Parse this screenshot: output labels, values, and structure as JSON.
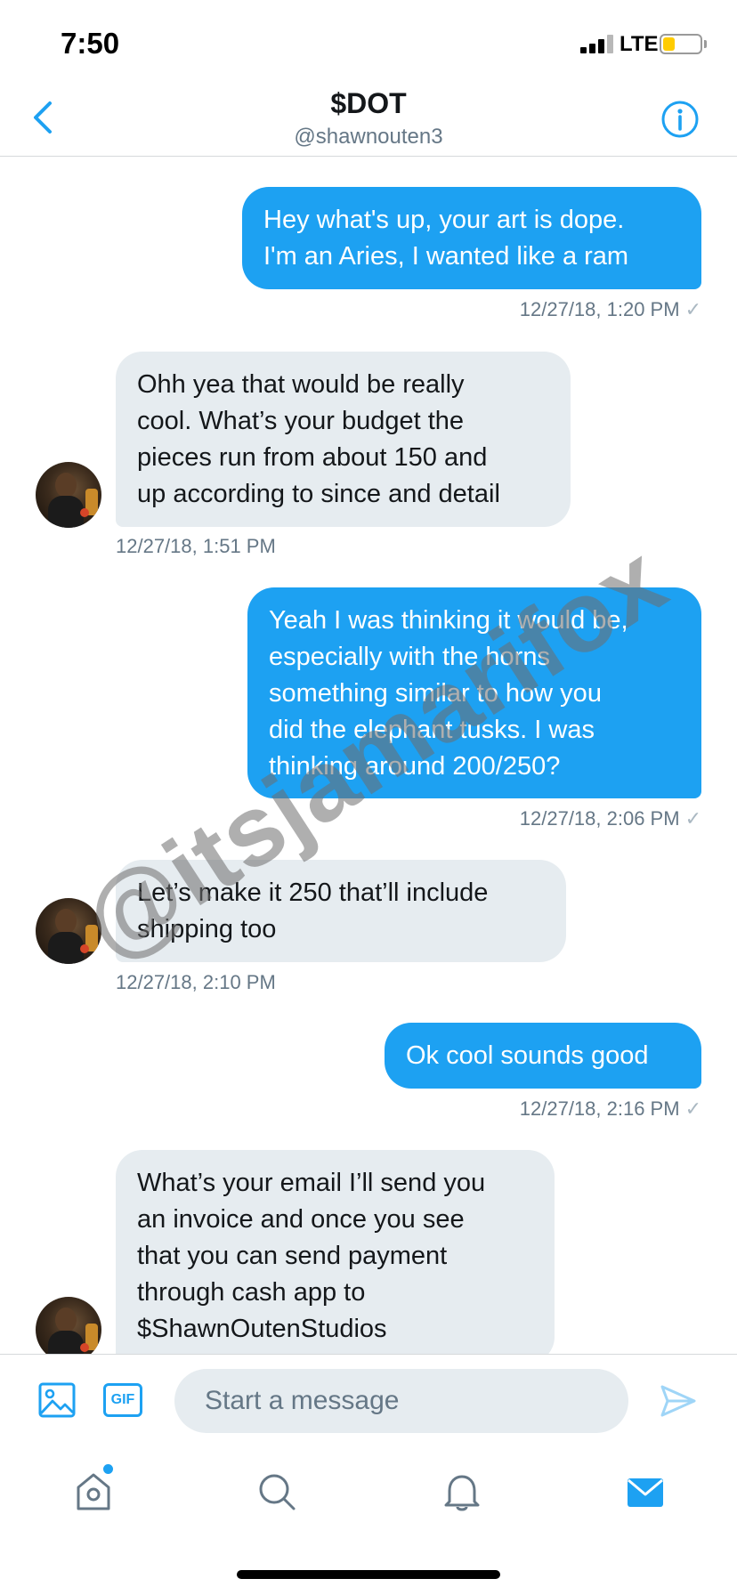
{
  "status_bar": {
    "time": "7:50",
    "network": "LTE"
  },
  "header": {
    "title": "$DOT",
    "handle": "@shawnouten3"
  },
  "messages": [
    {
      "direction": "sent",
      "lines": [
        "Hey what's up, your art is dope.",
        "I'm an Aries, I wanted like a ram"
      ],
      "timestamp": "12/27/18, 1:20 PM",
      "status": "✓"
    },
    {
      "direction": "received",
      "lines": [
        "Ohh yea that would be really",
        "cool. What’s your budget the",
        "pieces run from about 150 and",
        "up according to since and detail"
      ],
      "timestamp": "12/27/18, 1:51 PM"
    },
    {
      "direction": "sent",
      "lines": [
        "Yeah I was thinking it would be,",
        "especially with the horns",
        "something similar to how you",
        "did the elephant tusks. I was",
        "thinking around 200/250?"
      ],
      "timestamp": "12/27/18, 2:06 PM",
      "status": "✓"
    },
    {
      "direction": "received",
      "lines": [
        "Let’s make it 250 that’ll include",
        "shipping too"
      ],
      "timestamp": "12/27/18, 2:10 PM"
    },
    {
      "direction": "sent",
      "lines": [
        "Ok cool sounds good"
      ],
      "timestamp": "12/27/18, 2:16 PM",
      "status": "✓"
    },
    {
      "direction": "received",
      "lines": [
        "What’s your email I’ll send you",
        "an invoice and once you see",
        "that you can send payment",
        "through cash app to",
        "$ShawnOutenStudios"
      ]
    }
  ],
  "watermark": "@itsjamarifox",
  "composer": {
    "gif_label": "GIF",
    "placeholder": "Start a message"
  },
  "tabs": [
    {
      "icon": "home-icon",
      "has_notification_dot": true
    },
    {
      "icon": "search-icon"
    },
    {
      "icon": "bell-icon"
    },
    {
      "icon": "mail-icon",
      "active": true
    }
  ],
  "colors": {
    "accent": "#1da1f2",
    "received_bubble": "#e6ecf0",
    "secondary_text": "#657786"
  }
}
